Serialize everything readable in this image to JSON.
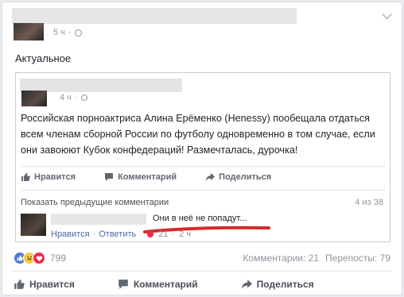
{
  "post": {
    "time": "5 ч",
    "status": "Актуальное"
  },
  "shared": {
    "time": "4 ч",
    "text": "Российская порноактриса Алина Ерёменко (Henessy) пообещала отдаться всем членам сборной России по футболу одновременно в том случае, если они завоюют Кубок конфедераций! Размечталась, дурочка!",
    "actions": {
      "like": "Нравится",
      "comment": "Комментарий",
      "share": "Поделиться"
    },
    "prev_comments": "Показать предыдущие комментарии",
    "prev_count": "4 из 38",
    "comment": {
      "text": "Они в неё не попадут...",
      "like": "Нравится",
      "reply": "Ответить",
      "reactions": "21",
      "time": "2 ч"
    }
  },
  "stats": {
    "reactions": "799",
    "comments": "Комментарии: 21",
    "shares": "Перепосты: 79"
  },
  "actions": {
    "like": "Нравится",
    "comment": "Комментарий",
    "share": "Поделиться"
  },
  "colors": {
    "like": "#4a7bd5",
    "haha": "#f7c94b",
    "love": "#f02849",
    "underline": "#d62b2b"
  }
}
